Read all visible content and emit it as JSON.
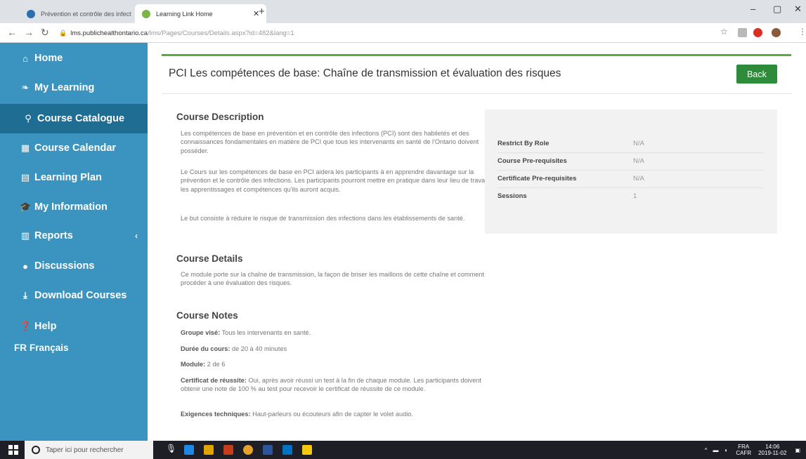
{
  "browser": {
    "tabs": [
      {
        "title": "Prévention et contrôle des infect",
        "active": false
      },
      {
        "title": "Learning Link Home",
        "active": true
      }
    ],
    "url_host": "lms.publichealthontario.ca",
    "url_path": "/lms/Pages/Courses/Details.aspx?id=482&lang=1"
  },
  "sidebar": {
    "items": [
      {
        "label": "Home",
        "icon": "home-icon",
        "glyph": "🏠"
      },
      {
        "label": "My Learning",
        "icon": "leaf-icon",
        "glyph": "❧"
      },
      {
        "label": "Course Catalogue",
        "icon": "search-icon",
        "glyph": "🔍"
      },
      {
        "label": "Course Calendar",
        "icon": "calendar-icon",
        "glyph": "▦"
      },
      {
        "label": "Learning Plan",
        "icon": "file-icon",
        "glyph": "▤"
      },
      {
        "label": "My Information",
        "icon": "graduation-cap-icon",
        "glyph": "🎓"
      },
      {
        "label": "Reports",
        "icon": "bar-chart-icon",
        "glyph": "📊"
      },
      {
        "label": "Discussions",
        "icon": "comments-icon",
        "glyph": "💬"
      },
      {
        "label": "Download Courses",
        "icon": "download-icon",
        "glyph": "⤓"
      },
      {
        "label": "Help",
        "icon": "question-circle-icon",
        "glyph": "?"
      },
      {
        "label": "Français",
        "prefix": "FR"
      }
    ],
    "active_index": 2,
    "reports_caret": "‹"
  },
  "page": {
    "title": "PCI Les compétences de base: Chaîne de transmission et évaluation des risques",
    "back_label": "Back",
    "description_heading": "Course Description",
    "description_paragraphs": [
      "Les compétences de base en prévention et en contrôle des infections (PCI) sont des habiletés et des connaissances fondamentales en matière de PCI que tous les intervenants en santé de l'Ontario doivent posséder.",
      "Le Cours sur les compétences de base en PCI aidera les participants à en apprendre davantage sur la prévention et le contrôle des infections. Les participants pourront mettre en pratique dans leur lieu de travail les apprentissages et compétences qu'ils auront acquis.",
      "Le but consiste à réduire le risque de transmission des infections dans les établissements de santé."
    ],
    "details_heading": "Course Details",
    "details_text": "Ce module porte sur la chaîne de transmission, la façon de briser les maillons de cette chaîne et comment procéder à une évaluation des risques.",
    "notes_heading": "Course Notes",
    "notes": [
      {
        "label": "Groupe visé:",
        "value": "Tous les intervenants en santé."
      },
      {
        "label": "Durée du cours:",
        "value": "de 20 à 40 minutes"
      },
      {
        "label": "Module:",
        "value": "2 de 6"
      },
      {
        "label": "Certificat de réussite:",
        "value": "Oui, après avoir réussi un test à la fin de chaque module. Les participants doivent obtenir une note de 100 % au test pour recevoir le certificat de réussite de ce module."
      },
      {
        "label": "Exigences techniques:",
        "value": "Haut-parleurs ou écouteurs afin de capter le volet audio."
      }
    ],
    "info": [
      {
        "key": "Restrict By Role",
        "value": "N/A"
      },
      {
        "key": "Course Pre-requisites",
        "value": "N/A"
      },
      {
        "key": "Certificate Pre-requisites",
        "value": "N/A"
      },
      {
        "key": "Sessions",
        "value": "1"
      }
    ]
  },
  "taskbar": {
    "search_placeholder": "Taper ici pour rechercher",
    "lang_line1": "FRA",
    "lang_line2": "CAFR",
    "time": "14:06",
    "date": "2019-11-02"
  },
  "colors": {
    "sidebar": "#3b93bf",
    "sidebar_active": "#1f6d93",
    "accent_green": "#2e8b3a",
    "panel_top_border": "#5ca93d"
  }
}
